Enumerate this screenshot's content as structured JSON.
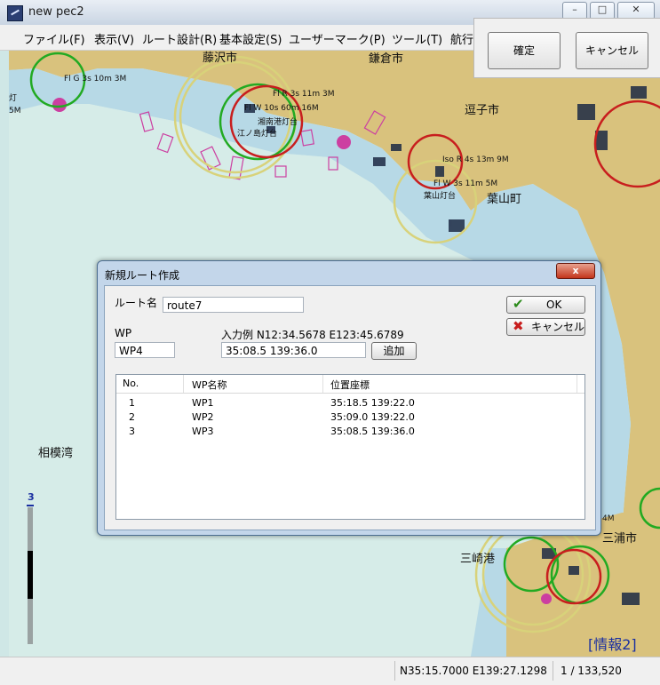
{
  "window": {
    "title": "new pec2"
  },
  "menu": [
    "ファイル(F)",
    "表示(V)",
    "ルート設計(R)",
    "基本設定(S)",
    "ユーザーマーク(P)",
    "ツール(T)",
    "航行支"
  ],
  "top_buttons": {
    "confirm": "確定",
    "cancel": "キャンセル"
  },
  "map": {
    "place_names": {
      "kamakura": "鎌倉市",
      "zushi": "逗子市",
      "hayama": "葉山町",
      "sagami_bay": "相模湾",
      "miura": "三浦市",
      "misaki": "三崎港",
      "fujisawa": "藤沢市",
      "enoshima": "江ノ島灯台",
      "shonan": "湘南港灯台",
      "hayama_light": "葉山灯台"
    },
    "light_labels": {
      "l1": "Fl G 3s 10m 3M",
      "l2": "Fl R 3s 11m 3M",
      "l3": "Iso R 4s 13m 9M",
      "l4": "Fl W 3s 11m 5M",
      "l5": "Fl W 10s 60m 16M",
      "l6": "灯",
      "l7": "5M",
      "l8": "4M"
    },
    "info_link": "[情報2]",
    "scale_value": "3"
  },
  "status": {
    "coords": "N35:15.7000 E139:27.1298",
    "scale": "1 / 133,520"
  },
  "dialog": {
    "title": "新規ルート作成",
    "close_symbol": "x",
    "route_name_label": "ルート名",
    "route_name_value": "route7",
    "wp_label": "WP",
    "wp_value": "WP4",
    "example_text": "入力例 N12:34.5678 E123:45.6789",
    "coord_value": "35:08.5 139:36.0",
    "add_button": "追加",
    "ok_button": "OK",
    "cancel_button": "キャンセル",
    "columns": [
      "No.",
      "WP名称",
      "位置座標"
    ],
    "rows": [
      {
        "no": "1",
        "name": "WP1",
        "coord": "35:18.5 139:22.0"
      },
      {
        "no": "2",
        "name": "WP2",
        "coord": "35:09.0 139:22.0"
      },
      {
        "no": "3",
        "name": "WP3",
        "coord": "35:08.5 139:36.0"
      }
    ]
  },
  "colors": {
    "sea": "#d6ece8",
    "land": "#d9c27d",
    "shallow": "#b7d9e6",
    "accent": "#1a2fa0"
  }
}
